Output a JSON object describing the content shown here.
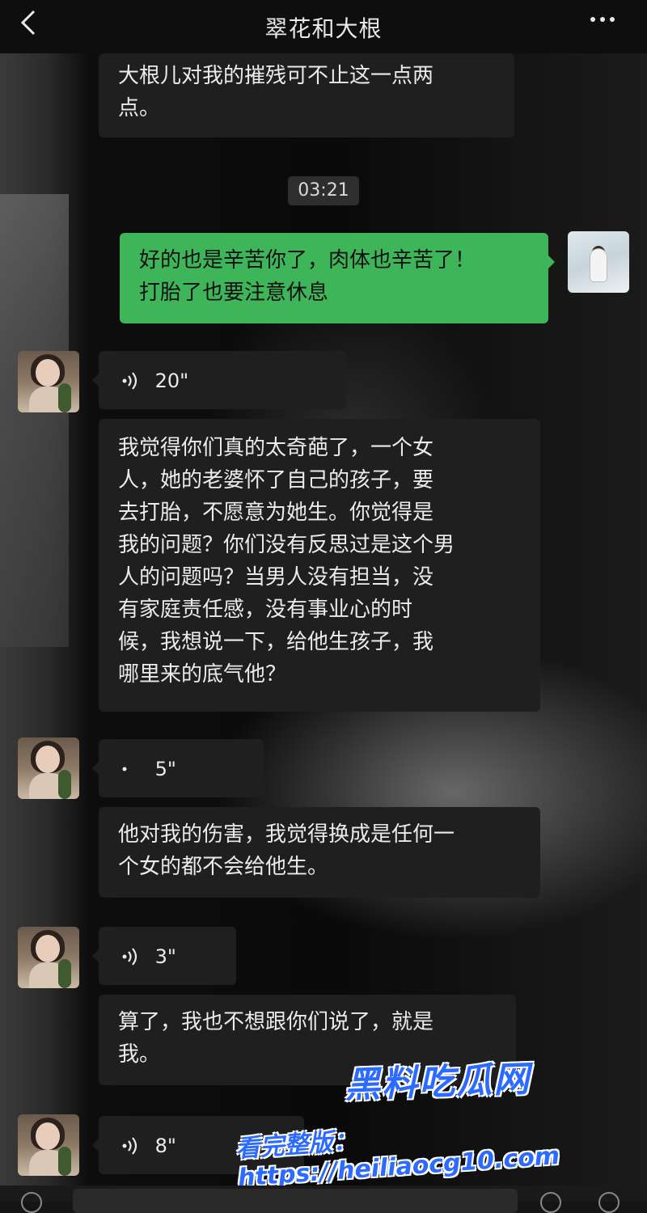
{
  "header": {
    "title": "翠花和大根",
    "back_icon": "chevron-left-icon",
    "more_icon": "more-dots-icon"
  },
  "messages": {
    "m1": {
      "text_line1": "大根儿对我的摧残可不止这一点两",
      "text_line2": "点。"
    },
    "time": "03:21",
    "m2": {
      "text_line1": "好的也是辛苦你了，肉体也辛苦了！",
      "text_line2": "打胎了也要注意休息"
    },
    "v1": {
      "duration": "20\""
    },
    "m3": {
      "lines": [
        "我觉得你们真的太奇葩了，一个女",
        "人，她的老婆怀了自己的孩子，要",
        "去打胎，不愿意为她生。你觉得是",
        "我的问题？你们没有反思过是这个男",
        "人的问题吗？当男人没有担当，没",
        "有家庭责任感，没有事业心的时",
        "候，我想说一下，给他生孩子，我",
        "哪里来的底气他？"
      ]
    },
    "v2": {
      "duration": "5\""
    },
    "m4": {
      "text_line1": "他对我的伤害，我觉得换成是任何一",
      "text_line2": "个女的都不会给他生。"
    },
    "v3": {
      "duration": "3\""
    },
    "m5": {
      "text_line1": "算了，我也不想跟你们说了，就是",
      "text_line2": "我。"
    },
    "v4": {
      "duration": "8\""
    }
  },
  "watermark": {
    "brand": "黑料吃瓜网",
    "url_line": "看完整版：https://heiliaocg10.com"
  },
  "colors": {
    "sent_bubble": "#3fb55a",
    "received_bubble": "#1f1f1f",
    "watermark": "#2c6bff"
  }
}
